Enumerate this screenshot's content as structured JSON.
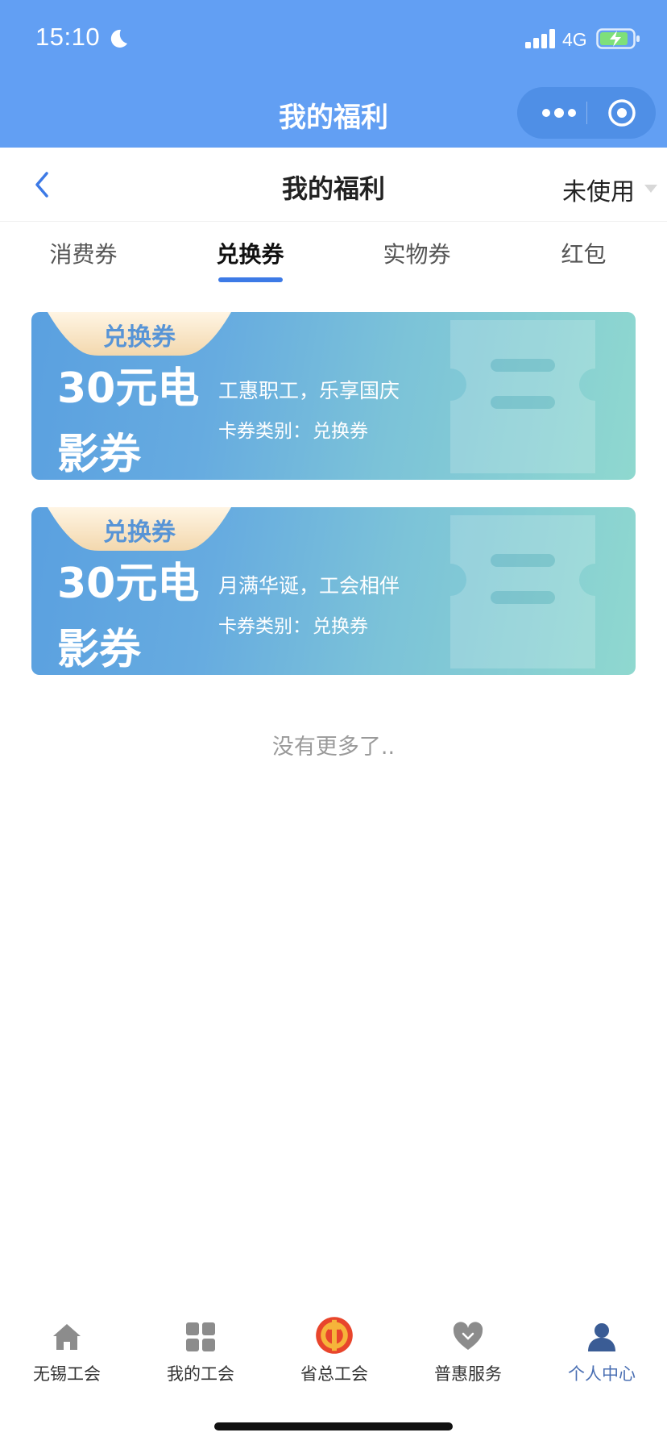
{
  "status_bar": {
    "time": "15:10",
    "network": "4G"
  },
  "wx_nav": {
    "title": "我的福利"
  },
  "page_header": {
    "title": "我的福利",
    "filter": "未使用"
  },
  "tabs": [
    {
      "label": "消费券",
      "active": false
    },
    {
      "label": "兑换券",
      "active": true
    },
    {
      "label": "实物券",
      "active": false
    },
    {
      "label": "红包",
      "active": false
    }
  ],
  "coupons": [
    {
      "tag": "兑换券",
      "name": "30元电影券",
      "slogan": "工惠职工，乐享国庆",
      "type_label": "卡券类别：",
      "type_value": "兑换券"
    },
    {
      "tag": "兑换券",
      "name": "30元电影券",
      "slogan": "月满华诞，工会相伴",
      "type_label": "卡券类别：",
      "type_value": "兑换券"
    }
  ],
  "no_more": "没有更多了..",
  "bottom_nav": [
    {
      "label": "无锡工会",
      "icon": "home-icon",
      "active": false
    },
    {
      "label": "我的工会",
      "icon": "grid-icon",
      "active": false
    },
    {
      "label": "省总工会",
      "icon": "union-emblem-icon",
      "active": false
    },
    {
      "label": "普惠服务",
      "icon": "heart-icon",
      "active": false
    },
    {
      "label": "个人中心",
      "icon": "person-icon",
      "active": true
    }
  ],
  "colors": {
    "topbar": "#629ff3",
    "accent": "#3d7ae6",
    "active_nav": "#4a6fb3",
    "tag_text": "#5794d6"
  }
}
